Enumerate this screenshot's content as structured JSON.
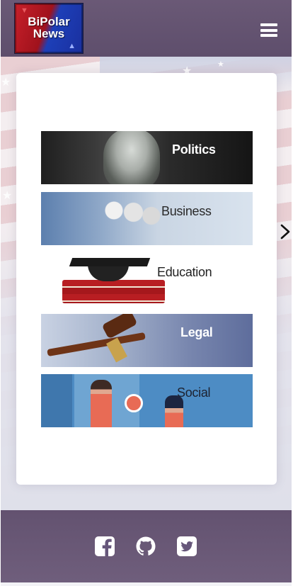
{
  "header": {
    "logo_text_line1": "BiPolar",
    "logo_text_line2": "News",
    "menu_icon": "hamburger-icon"
  },
  "categories": [
    {
      "label": "Politics"
    },
    {
      "label": "Business"
    },
    {
      "label": "Education"
    },
    {
      "label": "Legal"
    },
    {
      "label": "Social"
    }
  ],
  "carousel": {
    "next_icon": "chevron-right-icon"
  },
  "footer": {
    "icons": [
      "facebook-icon",
      "github-icon",
      "twitter-icon"
    ]
  },
  "colors": {
    "header_bg": "#5e4e6c",
    "footer_bg": "#6a5976",
    "card_bg": "#ffffff"
  }
}
